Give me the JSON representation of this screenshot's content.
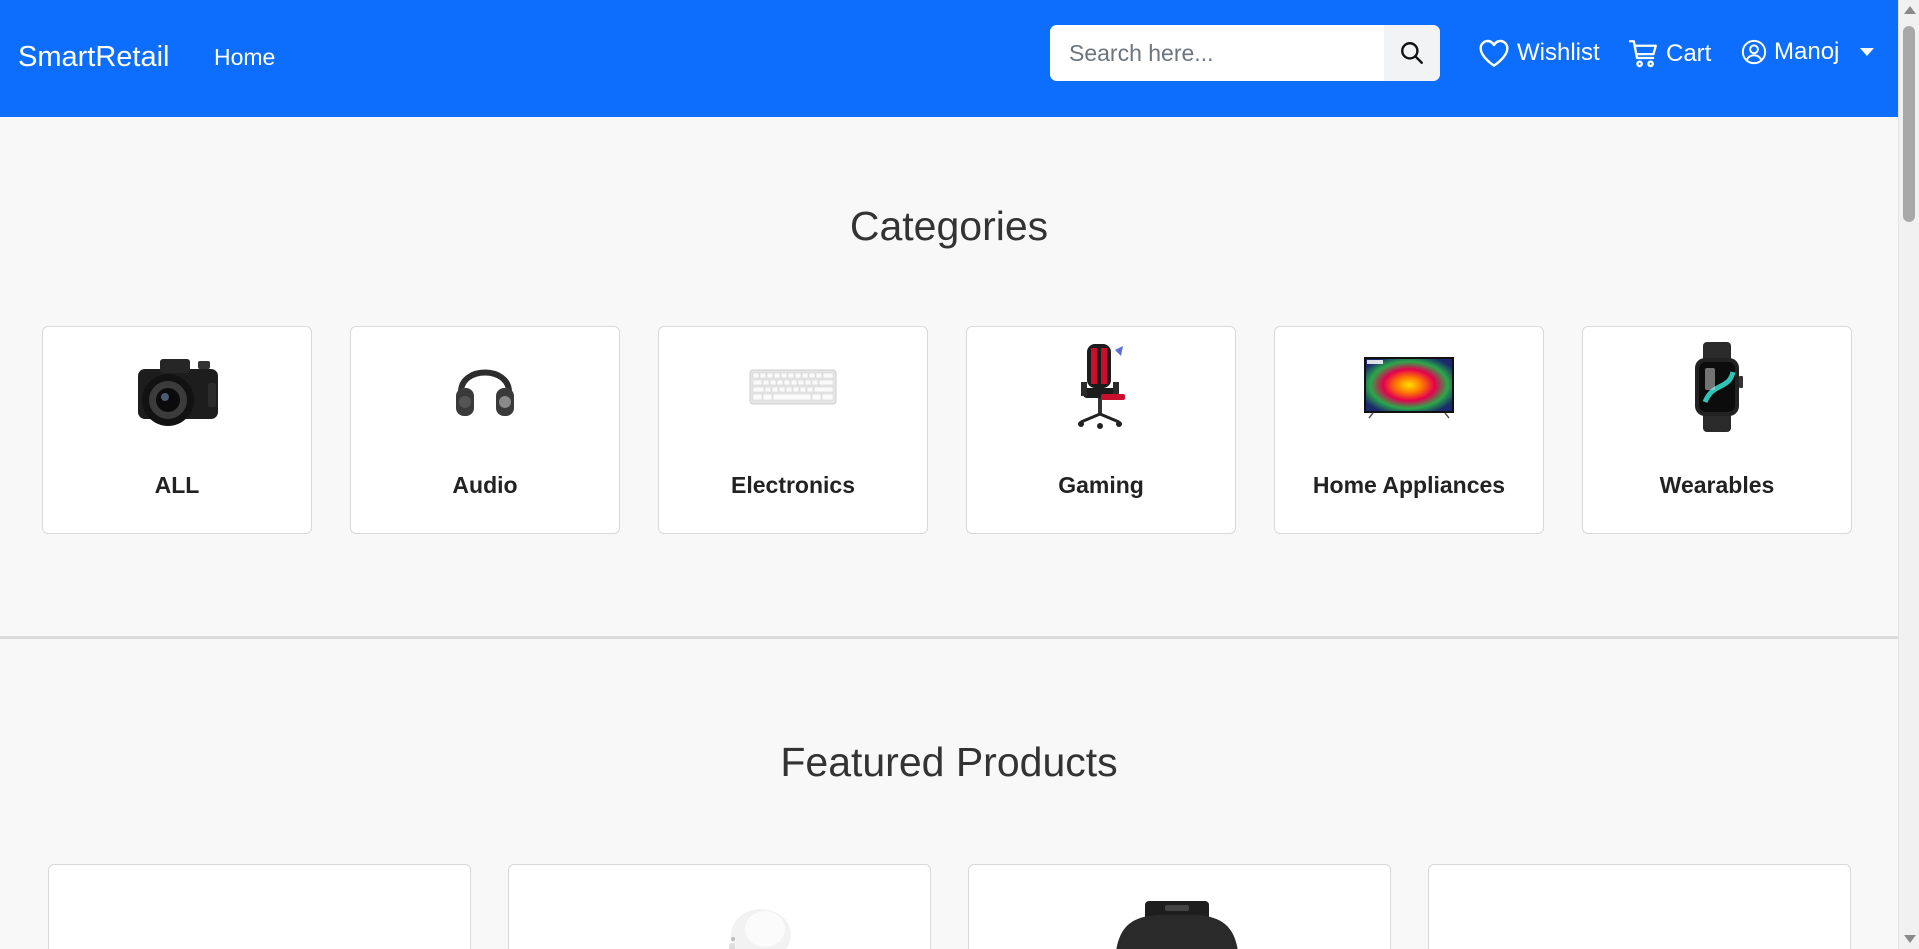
{
  "colors": {
    "navbar": "#0d6efd",
    "page_bg": "#f8f8f8",
    "card_border": "#d9d9d9"
  },
  "navbar": {
    "brand": "SmartRetail",
    "home": "Home",
    "search": {
      "placeholder": "Search here...",
      "icon": "search-icon"
    },
    "wishlist": {
      "label": "Wishlist",
      "icon": "heart-icon"
    },
    "cart": {
      "label": "Cart",
      "icon": "cart-icon"
    },
    "user": {
      "label": "Manoj",
      "icon": "user-circle-icon"
    }
  },
  "categories": {
    "title": "Categories",
    "items": [
      {
        "label": "ALL",
        "icon": "camera-image"
      },
      {
        "label": "Audio",
        "icon": "headphones-image"
      },
      {
        "label": "Electronics",
        "icon": "keyboard-image"
      },
      {
        "label": "Gaming",
        "icon": "gaming-chair-image"
      },
      {
        "label": "Home Appliances",
        "icon": "tv-image"
      },
      {
        "label": "Wearables",
        "icon": "smartwatch-image"
      }
    ]
  },
  "featured": {
    "title": "Featured Products",
    "items": [
      {
        "icon": "product-image"
      },
      {
        "icon": "earbuds-image"
      },
      {
        "icon": "smartwatch-image"
      },
      {
        "icon": "product-image"
      }
    ]
  }
}
